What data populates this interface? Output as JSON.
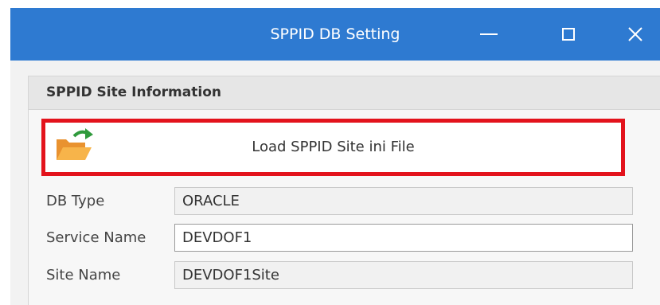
{
  "window": {
    "title": "SPPID DB Setting",
    "title_bar_color": "#2e7ad1",
    "controls": [
      "minimize-icon",
      "maximize-icon",
      "close-icon"
    ]
  },
  "group": {
    "title": "SPPID Site Information"
  },
  "load_button": {
    "label": "Load SPPID Site ini File",
    "icon": "folder-open-icon",
    "highlight_color": "#e3131c"
  },
  "fields": {
    "db_type": {
      "label": "DB Type",
      "value": "ORACLE"
    },
    "service_name": {
      "label": "Service Name",
      "value": "DEVDOF1"
    },
    "site_name": {
      "label": "Site Name",
      "value": "DEVDOF1Site"
    }
  }
}
